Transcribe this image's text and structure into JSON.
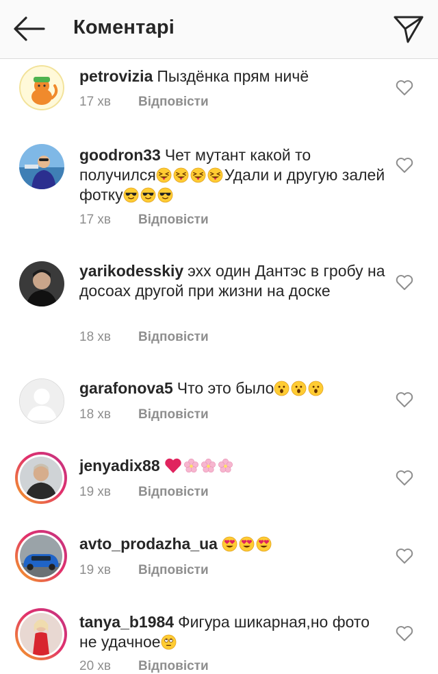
{
  "header": {
    "title": "Коментарі",
    "back_icon": "arrow-left-icon",
    "share_icon": "paper-plane-icon"
  },
  "reply_label": "Відповісти",
  "comments": [
    {
      "username": "petrovizia",
      "text": "Пыздёнка прям ничё",
      "emoji": [],
      "time": "17 хв"
    },
    {
      "username": "goodron33",
      "text": "Чет мутант какой то получился",
      "emoji": [
        "squinting-tongue-face",
        "squinting-tongue-face",
        "squinting-tongue-face",
        "squinting-tongue-face"
      ],
      "text2": "Удали и другую залей фотку",
      "emoji2": [
        "sunglasses-face",
        "sunglasses-face",
        "sunglasses-face"
      ],
      "time": "17 хв"
    },
    {
      "username": "yarikodesskiy",
      "text": "эхх один Дантэс в гробу на досоах другой при жизни на доске",
      "emoji": [],
      "time": "18 хв"
    },
    {
      "username": "garafonova5",
      "text": "Что это было",
      "emoji": [
        "astonished-face",
        "astonished-face",
        "astonished-face"
      ],
      "time": "18 хв"
    },
    {
      "username": "jenyadix88",
      "text": "",
      "emoji": [
        "red-heart",
        "cherry-blossom",
        "cherry-blossom",
        "cherry-blossom"
      ],
      "time": "19 хв"
    },
    {
      "username": "avto_prodazha_ua",
      "text": "",
      "emoji": [
        "heart-eyes-face",
        "heart-eyes-face",
        "heart-eyes-face"
      ],
      "time": "19 хв"
    },
    {
      "username": "tanya_b1984",
      "text": "Фигура шикарная,но фото не удачное",
      "emoji": [
        "face-with-rolling-eyes"
      ],
      "time": "20 хв"
    }
  ],
  "colors": {
    "text": "#262626",
    "secondary": "#8e8e8e",
    "header_bg": "#fafafa",
    "story_ring_start": "#f5a623",
    "story_ring_end": "#c13584",
    "heart_red": "#e0245e"
  }
}
